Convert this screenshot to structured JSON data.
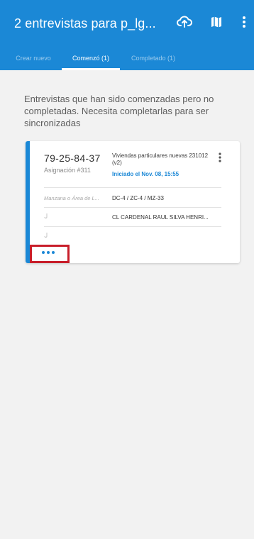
{
  "appbar": {
    "title": "2 entrevistas para p_lg...",
    "icons": [
      "cloud-sync-icon",
      "map-icon",
      "more-vert-icon"
    ],
    "color": "#1b88d6"
  },
  "tabs": [
    {
      "label": "Crear nuevo",
      "active": false
    },
    {
      "label": "Comenzó (1)",
      "active": true
    },
    {
      "label": "Completado (1)",
      "active": false
    }
  ],
  "description": "Entrevistas que han sido comenzadas pero no completadas. Necesita completarlas para ser sincronizadas",
  "card": {
    "id": "79-25-84-37",
    "assignment": "Asignación #311",
    "survey": "Viviendas particulares nuevas 231012 (v2)",
    "started": "Iniciado el Nov. 08, 15:55",
    "rows": [
      {
        "label": "Manzana o Área de L...",
        "value": "DC-4 / ZC-4 / MZ-33"
      },
      {
        "label": "",
        "value": "CL CARDENAL RAUL SILVA HENRI..."
      },
      {
        "label": "",
        "value": ""
      }
    ],
    "accent": "#1b88d6",
    "highlight_color": "#c81e2a"
  }
}
